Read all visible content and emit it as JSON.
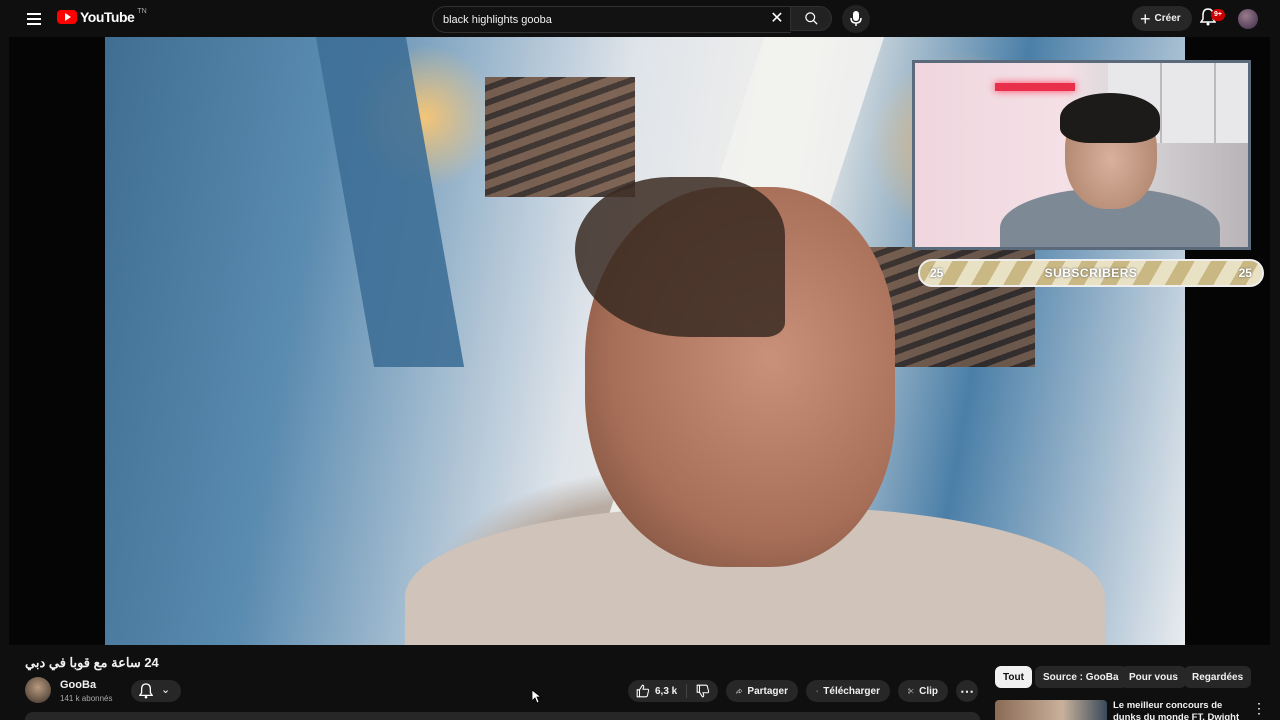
{
  "header": {
    "logo_text": "YouTube",
    "logo_country": "TN",
    "search_value": "black highlights gooba",
    "create_label": "Créer",
    "notification_count": "9+"
  },
  "overlay": {
    "sub_left": "25",
    "sub_label": "SUBSCRIBERS",
    "sub_right": "25"
  },
  "video": {
    "title": "24 ساعة مع قوبا في دبي",
    "channel_name": "GooBa",
    "channel_subs": "141 k abonnés",
    "likes": "6,3 k",
    "share_label": "Partager",
    "download_label": "Télécharger",
    "clip_label": "Clip",
    "more_label": "⋯"
  },
  "filters": {
    "chips": [
      "Tout",
      "Source : GooBa",
      "Pour vous",
      "Regardées"
    ]
  },
  "recommendation": {
    "title": "Le meilleur concours de dunks du monde FT. Dwight Howard"
  },
  "colors": {
    "accent": "#ff0000",
    "background": "#0f0f0f",
    "pill": "#272727",
    "badge": "#cc0000"
  },
  "icons": [
    "menu-icon",
    "youtube-logo-icon",
    "close-icon",
    "search-icon",
    "mic-icon",
    "plus-icon",
    "bell-icon",
    "thumbs-up-icon",
    "thumbs-down-icon",
    "share-icon",
    "download-icon",
    "scissors-icon",
    "more-icon",
    "chevron-down-icon"
  ]
}
